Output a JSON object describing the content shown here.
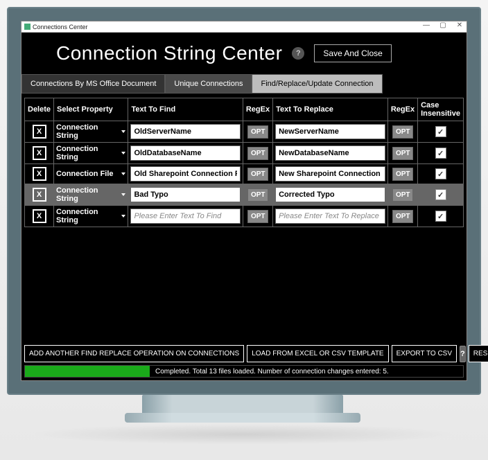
{
  "window_title": "Connections Center",
  "header": {
    "title": "Connection String Center",
    "help_glyph": "?",
    "save_close": "Save And Close"
  },
  "tabs": [
    {
      "label": "Connections By MS Office Document",
      "active": false
    },
    {
      "label": "Unique Connections",
      "active": false
    },
    {
      "label": "Find/Replace/Update Connection",
      "active": true
    }
  ],
  "columns": {
    "delete": "Delete",
    "select_property": "Select Property",
    "text_to_find": "Text To Find",
    "regex": "RegEx",
    "text_to_replace": "Text To Replace",
    "regex2": "RegEx",
    "case_insensitive": "Case Insensitive"
  },
  "rows": [
    {
      "delete": "X",
      "property": "Connection String",
      "find": "OldServerName",
      "opt": "OPT",
      "replace": "NewServerName",
      "opt2": "OPT",
      "ci": true,
      "selected": false
    },
    {
      "delete": "X",
      "property": "Connection String",
      "find": "OldDatabaseName",
      "opt": "OPT",
      "replace": "NewDatabaseName",
      "opt2": "OPT",
      "ci": true,
      "selected": false
    },
    {
      "delete": "X",
      "property": "Connection File",
      "find": "Old Sharepoint Connection File",
      "opt": "OPT",
      "replace": "New Sharepoint Connection File",
      "opt2": "OPT",
      "ci": true,
      "selected": false
    },
    {
      "delete": "X",
      "property": "Connection String",
      "find": "Bad Typo",
      "opt": "OPT",
      "replace": "Corrected Typo",
      "opt2": "OPT",
      "ci": true,
      "selected": true
    },
    {
      "delete": "X",
      "property": "Connection String",
      "find": "",
      "opt": "OPT",
      "replace": "",
      "opt2": "OPT",
      "ci": true,
      "selected": false,
      "placeholder": true
    }
  ],
  "placeholders": {
    "find": "Please Enter Text To Find",
    "replace": "Please Enter Text To Replace"
  },
  "footer": {
    "add": "ADD ANOTHER FIND REPLACE OPERATION ON CONNECTIONS",
    "load": "LOAD FROM EXCEL OR CSV TEMPLATE",
    "export": "EXPORT TO CSV",
    "help": "?",
    "reset": "RESET"
  },
  "status": "Completed. Total 13 files loaded. Number of connection changes entered: 5."
}
